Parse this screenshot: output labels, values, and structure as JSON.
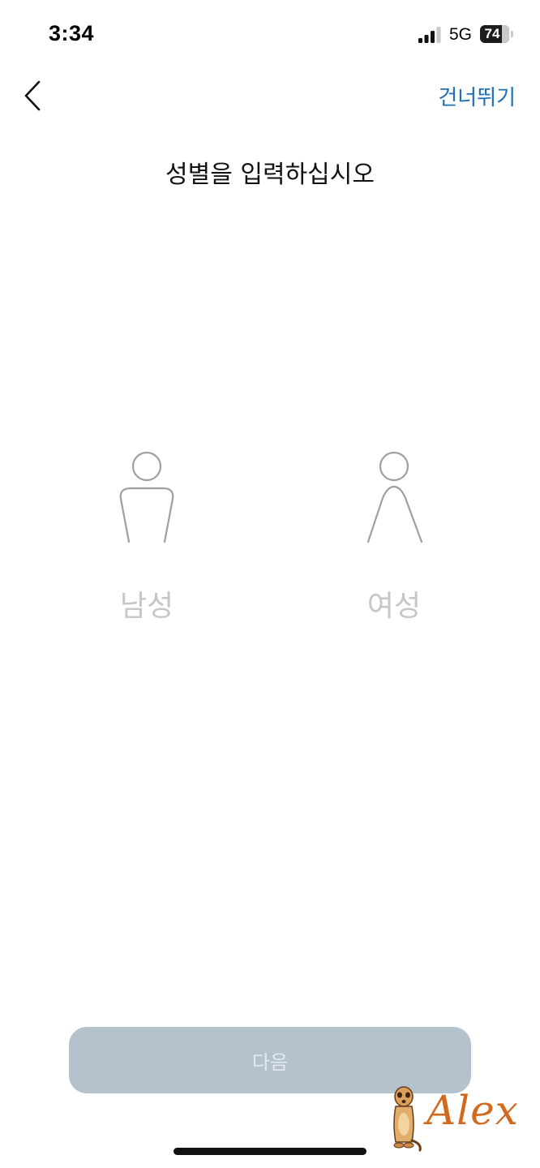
{
  "status_bar": {
    "time": "3:34",
    "network": "5G",
    "battery_level": "74"
  },
  "nav": {
    "back_icon": "chevron-left-icon",
    "skip_label": "건너뛰기"
  },
  "page": {
    "title": "성별을 입력하십시오"
  },
  "gender_options": [
    {
      "label": "남성",
      "icon": "male-person-icon"
    },
    {
      "label": "여성",
      "icon": "female-person-icon"
    }
  ],
  "footer": {
    "next_label": "다음"
  },
  "watermark": {
    "text": "Alex",
    "icon": "meerkat-icon"
  },
  "colors": {
    "accent": "#1f6fb4",
    "option_label": "#c4c6ca",
    "figure_stroke": "#9d9fa3",
    "button_disabled": "#b4c2cd",
    "button_text": "#e3e9ee"
  }
}
